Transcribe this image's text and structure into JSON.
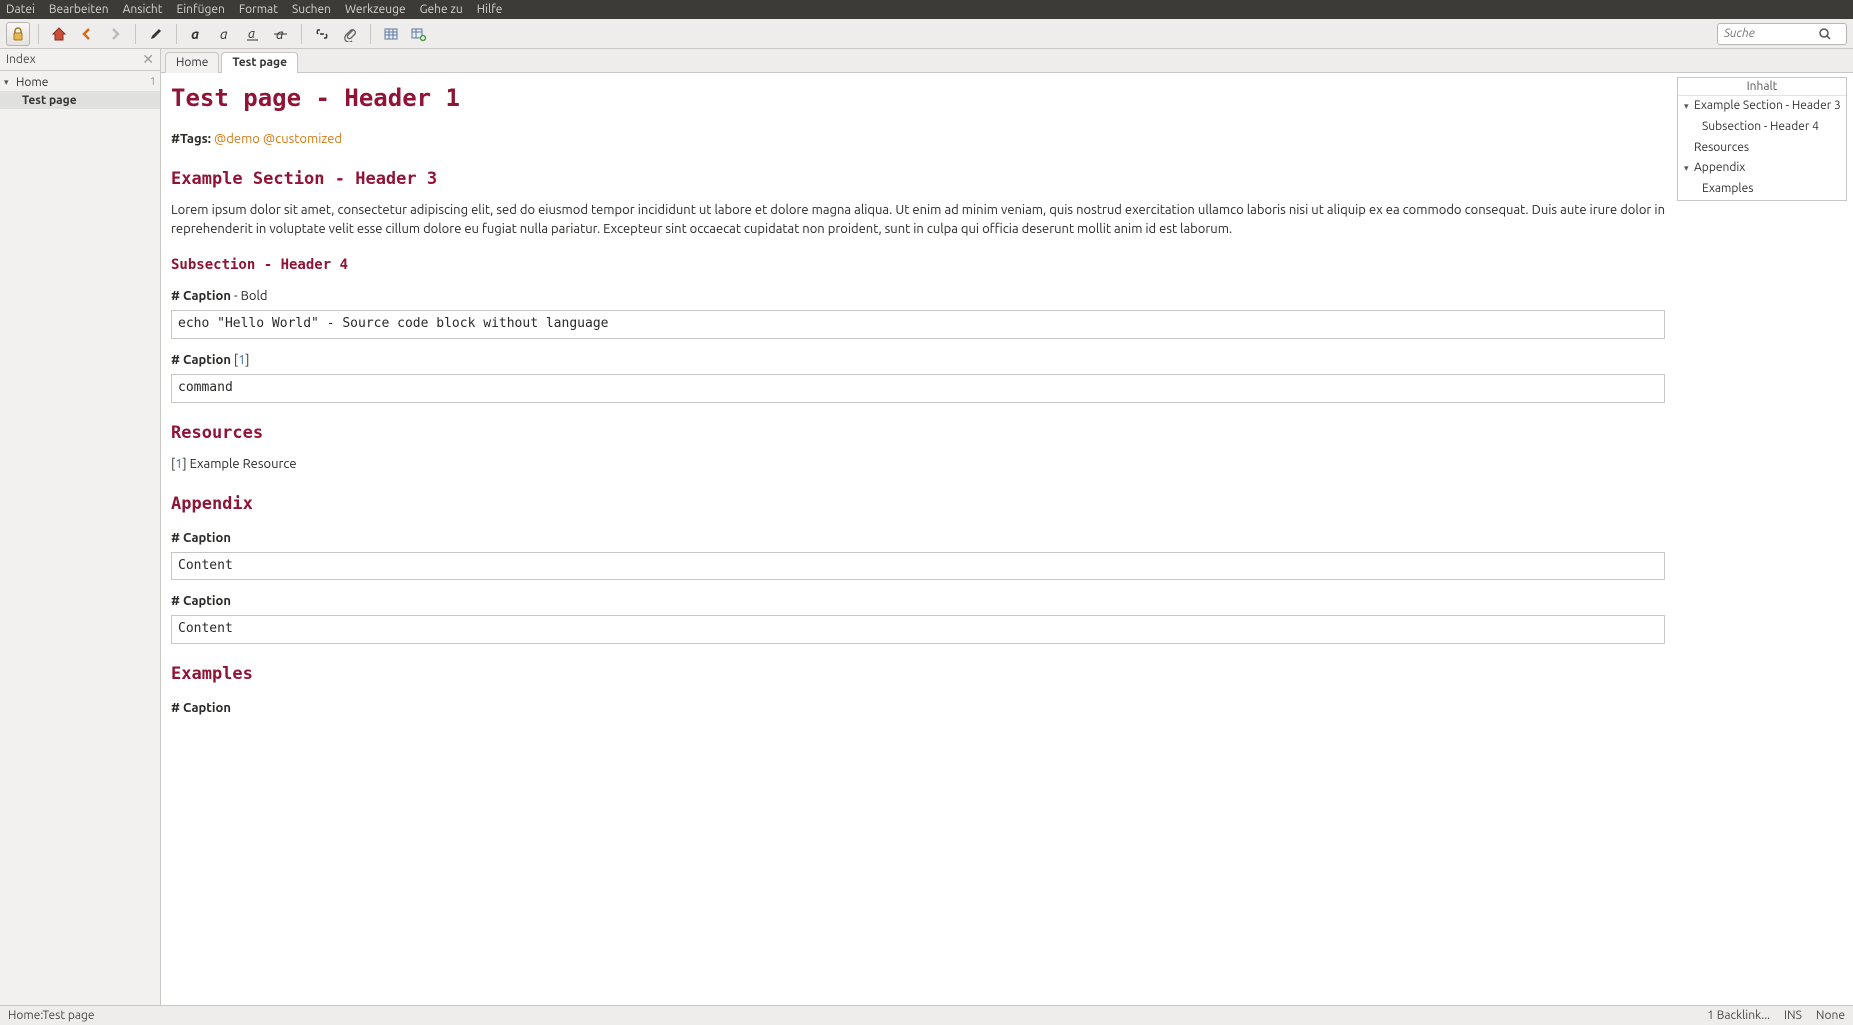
{
  "menubar": [
    "Datei",
    "Bearbeiten",
    "Ansicht",
    "Einfügen",
    "Format",
    "Suchen",
    "Werkzeuge",
    "Gehe zu",
    "Hilfe"
  ],
  "search": {
    "placeholder": "Suche"
  },
  "sidebar": {
    "title": "Index",
    "root": {
      "label": "Home",
      "count": "1"
    },
    "child": {
      "label": "Test page"
    }
  },
  "tabs": [
    {
      "label": "Home",
      "active": false
    },
    {
      "label": "Test page",
      "active": true
    }
  ],
  "toc": {
    "title": "Inhalt",
    "items": [
      {
        "label": "Example Section - Header 3",
        "level": 1,
        "expand": true
      },
      {
        "label": "Subsection - Header 4",
        "level": 2,
        "expand": false
      },
      {
        "label": "Resources",
        "level": 1,
        "expand": false
      },
      {
        "label": "Appendix",
        "level": 1,
        "expand": true
      },
      {
        "label": "Examples",
        "level": 2,
        "expand": false
      }
    ]
  },
  "page": {
    "h1": "Test page - Header 1",
    "tags_label": "#Tags: ",
    "tags": [
      "@demo",
      "@customized"
    ],
    "h3_1": "Example Section - Header 3",
    "lorem": "Lorem ipsum dolor sit amet, consectetur adipiscing elit, sed do eiusmod tempor incididunt ut labore et dolore magna aliqua. Ut enim ad minim veniam, quis nostrud exercitation ullamco laboris nisi ut aliquip ex ea commodo consequat. Duis aute irure dolor in reprehenderit in voluptate velit esse cillum dolore eu fugiat nulla pariatur. Excepteur sint occaecat cupidatat non proident, sunt in culpa qui officia deserunt mollit anim id est laborum.",
    "h4_1": "Subsection - Header 4",
    "cap1_bold": "# Caption",
    "cap1_rest": " - Bold",
    "code1": "echo \"Hello World\" - Source code block without language",
    "cap2_bold": "# Caption",
    "cap2_ref_open": " [",
    "cap2_ref": "1",
    "cap2_ref_close": "]",
    "code2": "command",
    "h3_2": "Resources",
    "res_open": "[",
    "res_num": "1",
    "res_close": "] Example Resource",
    "h3_3": "Appendix",
    "app_cap1": "# Caption",
    "app_code1": "Content",
    "app_cap2": "# Caption",
    "app_code2": "Content",
    "h3_4": "Examples",
    "ex_cap": "# Caption"
  },
  "statusbar": {
    "path": "Home:Test page",
    "backlinks": "1 Backlink...",
    "mode": "INS",
    "right": "None"
  }
}
